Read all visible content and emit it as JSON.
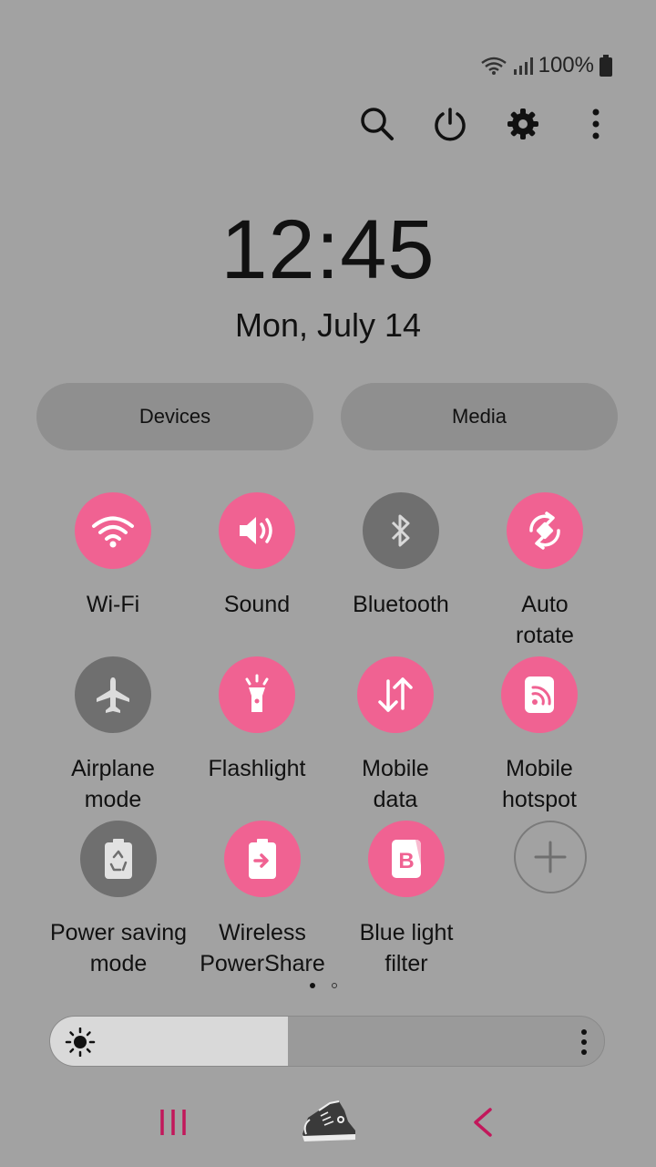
{
  "status": {
    "battery_text": "100%",
    "icons": [
      "wifi-icon",
      "signal-icon",
      "battery-icon"
    ]
  },
  "toolbar": {
    "icons": [
      "search-icon",
      "power-icon",
      "settings-gear-icon",
      "more-vertical-icon"
    ]
  },
  "clock": {
    "time": "12:45",
    "date": "Mon, July 14"
  },
  "pills": {
    "devices": "Devices",
    "media": "Media"
  },
  "tiles": [
    {
      "label_lines": [
        "Wi-Fi"
      ],
      "state": "on",
      "icon": "wifi-icon"
    },
    {
      "label_lines": [
        "Sound"
      ],
      "state": "on",
      "icon": "sound-icon"
    },
    {
      "label_lines": [
        "Bluetooth"
      ],
      "state": "off",
      "icon": "bluetooth-icon"
    },
    {
      "label_lines": [
        "Auto",
        "rotate"
      ],
      "state": "on",
      "icon": "auto-rotate-icon"
    },
    {
      "label_lines": [
        "Airplane",
        "mode"
      ],
      "state": "off",
      "icon": "airplane-icon"
    },
    {
      "label_lines": [
        "Flashlight"
      ],
      "state": "on",
      "icon": "flashlight-icon"
    },
    {
      "label_lines": [
        "Mobile",
        "data"
      ],
      "state": "on",
      "icon": "mobile-data-icon"
    },
    {
      "label_lines": [
        "Mobile",
        "hotspot"
      ],
      "state": "on",
      "icon": "hotspot-icon"
    },
    {
      "label_lines": [
        "Power saving",
        "mode"
      ],
      "state": "off",
      "icon": "power-saving-icon"
    },
    {
      "label_lines": [
        "Wireless",
        "PowerShare"
      ],
      "state": "on",
      "icon": "wireless-powershare-icon"
    },
    {
      "label_lines": [
        "Blue light",
        "filter"
      ],
      "state": "on",
      "icon": "blue-light-filter-icon"
    },
    {
      "label_lines": [],
      "state": "add",
      "icon": "add-icon"
    }
  ],
  "page_indicator": {
    "current": 1,
    "total": 2
  },
  "brightness": {
    "level": 0.43,
    "icon": "brightness-sun-icon"
  },
  "nav": {
    "icons": [
      "recent-apps-icon",
      "home-sneaker-icon",
      "back-icon"
    ]
  },
  "colors": {
    "accent": "#f06292",
    "tile_off": "#6f6f6f",
    "background": "#a2a2a2",
    "nav_accent": "#c2185b"
  }
}
